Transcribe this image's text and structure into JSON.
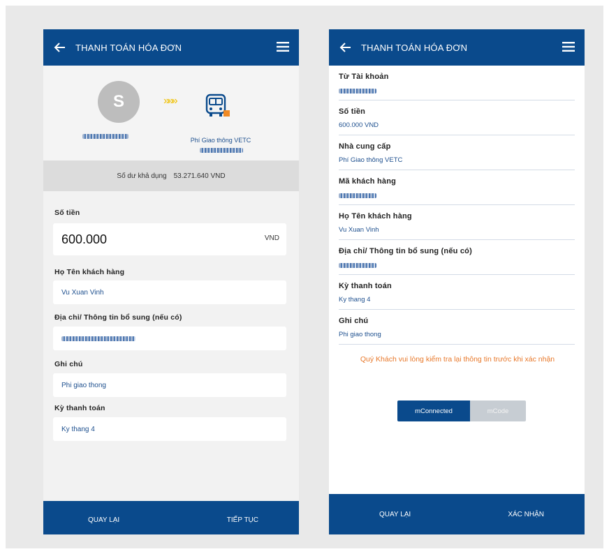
{
  "colors": {
    "primary": "#0a4a8c",
    "warning": "#e8782a",
    "link": "#1d4f8e"
  },
  "left": {
    "title": "THANH TOÁN HÓA ĐƠN",
    "avatar_letter": "S",
    "arrows": "»»»",
    "provider_name": "Phí Giao thông VETC",
    "balance_label": "Số dư khả dụng",
    "balance_value": "53.271.640 VND",
    "amount_label": "Số tiền",
    "amount_value": "600.000",
    "amount_currency": "VND",
    "name_label": "Họ Tên khách hàng",
    "name_value": "Vu Xuan Vinh",
    "address_label": "Địa chỉ/ Thông tin bổ sung (nếu có)",
    "note_label": "Ghi chú",
    "note_value": "Phi giao thong",
    "period_label": "Kỳ thanh toán",
    "period_value": "Ky thang 4",
    "btn_back": "QUAY LẠI",
    "btn_next": "TIẾP TỤC"
  },
  "right": {
    "title": "THANH TOÁN HÓA ĐƠN",
    "items": [
      {
        "label": "Từ Tài khoản",
        "value": ""
      },
      {
        "label": "Số tiền",
        "value": "600.000 VND"
      },
      {
        "label": "Nhà cung cấp",
        "value": "Phí Giao thông VETC"
      },
      {
        "label": "Mã khách hàng",
        "value": ""
      },
      {
        "label": "Họ Tên khách hàng",
        "value": "Vu Xuan Vinh"
      },
      {
        "label": "Địa chỉ/ Thông tin bổ sung (nếu có)",
        "value": ""
      },
      {
        "label": "Kỳ thanh toán",
        "value": "Ky thang 4"
      },
      {
        "label": "Ghi chú",
        "value": "Phi giao thong"
      }
    ],
    "note": "Quý Khách vui lòng kiểm tra lại thông tin trước khi xác nhận",
    "toggle_on": "mConnected",
    "toggle_off": "mCode",
    "btn_back": "QUAY LẠI",
    "btn_confirm": "XÁC NHẬN"
  }
}
